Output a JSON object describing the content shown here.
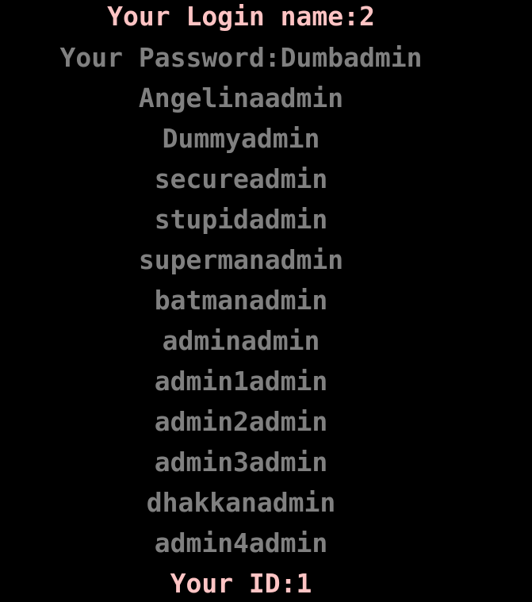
{
  "terminal": {
    "login_line": "Your Login name:2",
    "password_line": "Your Password:Dumbadmin",
    "passwords": [
      "Angelinaadmin",
      "Dummyadmin",
      "secureadmin",
      "stupidadmin",
      "supermanadmin",
      "batmanadmin",
      "adminadmin",
      "admin1admin",
      "admin2admin",
      "admin3admin",
      "dhakkanadmin",
      "admin4admin"
    ],
    "id_line": "Your ID:1"
  },
  "colors": {
    "background": "#000000",
    "highlight_text": "#ffc4c4",
    "normal_text": "#808080"
  }
}
